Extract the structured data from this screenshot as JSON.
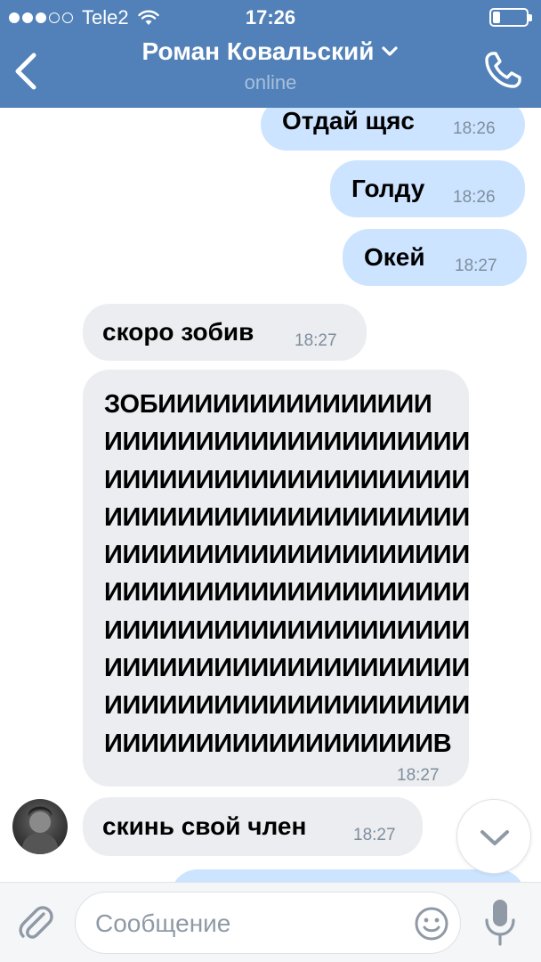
{
  "status_bar": {
    "carrier": "Tele2",
    "time": "17:26"
  },
  "header": {
    "name": "Роман Ковальский",
    "status": "online"
  },
  "messages": [
    {
      "dir": "out",
      "text": "Отдай щяс",
      "time": "18:26"
    },
    {
      "dir": "out",
      "text": "Голду",
      "time": "18:26"
    },
    {
      "dir": "out",
      "text": "Окей",
      "time": "18:27"
    },
    {
      "dir": "in",
      "text": "скоро зобив",
      "time": "18:27"
    },
    {
      "dir": "in",
      "lines": [
        "ЗОБИИИИИИИИИИИИИИИ",
        "ИИИИИИИИИИИИИИИИИИИИ",
        "ИИИИИИИИИИИИИИИИИИИИ",
        "ИИИИИИИИИИИИИИИИИИИИ",
        "ИИИИИИИИИИИИИИИИИИИИ",
        "ИИИИИИИИИИИИИИИИИИИИ",
        "ИИИИИИИИИИИИИИИИИИИИ",
        "ИИИИИИИИИИИИИИИИИИИИ",
        "ИИИИИИИИИИИИИИИИИИИИ",
        "ИИИИИИИИИИИИИИИИИИВ"
      ],
      "time": "18:27"
    },
    {
      "dir": "in",
      "text": "скинь свой член",
      "time": "18:27"
    }
  ],
  "composer": {
    "placeholder": "Сообщение"
  },
  "colors": {
    "header": "#5181b8",
    "outgoing_bubble": "#cce4ff",
    "incoming_bubble": "#ebedf0"
  },
  "icons": [
    "back-chevron-icon",
    "dropdown-chevron-icon",
    "phone-icon",
    "scroll-down-chevron-icon",
    "paperclip-icon",
    "smile-icon",
    "microphone-icon",
    "wifi-icon",
    "battery-icon"
  ]
}
